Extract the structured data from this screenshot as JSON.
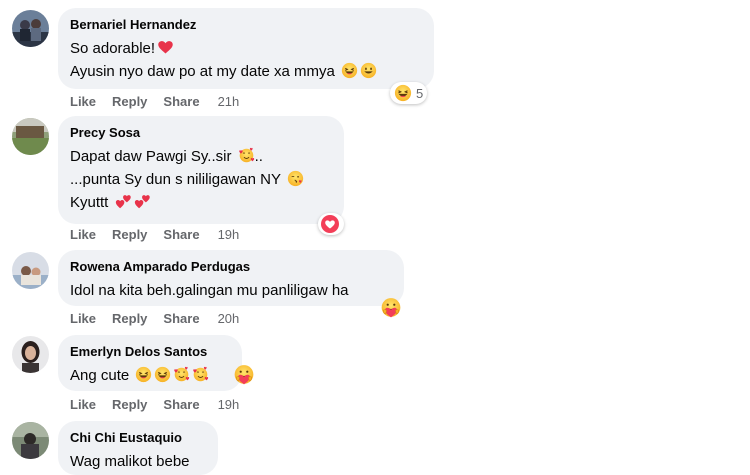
{
  "actions": {
    "like": "Like",
    "reply": "Reply",
    "share": "Share"
  },
  "comments": [
    {
      "author": "Bernariel Hernandez",
      "lines": [
        "So adorable!",
        "Ayusin nyo daw po at my date xa mmya"
      ],
      "time": "21h",
      "reaction_count": "5",
      "reaction_icons": [
        "haha-icon"
      ]
    },
    {
      "author": "Precy Sosa",
      "lines": [
        "Dapat daw Pawgi Sy..sir",
        "...punta Sy dun s nililigawan NY",
        "Kyuttt"
      ],
      "time": "19h",
      "reaction_icons": [
        "love-icon"
      ]
    },
    {
      "author": "Rowena Amparado Perdugas",
      "lines": [
        "Idol na kita beh.galingan mu panliligaw ha"
      ],
      "time": "20h",
      "reaction_icons": [
        "care-icon"
      ]
    },
    {
      "author": "Emerlyn Delos Santos",
      "lines": [
        "Ang cute"
      ],
      "time": "19h",
      "reaction_icons": [
        "care-icon"
      ]
    },
    {
      "author": "Chi Chi Eustaquio",
      "lines": [
        "Wag malikot bebe"
      ]
    }
  ],
  "colors": {
    "bubble": "#f0f2f5",
    "action_text": "#65676b",
    "love": "#f33e58",
    "haha": "#f7b125"
  }
}
